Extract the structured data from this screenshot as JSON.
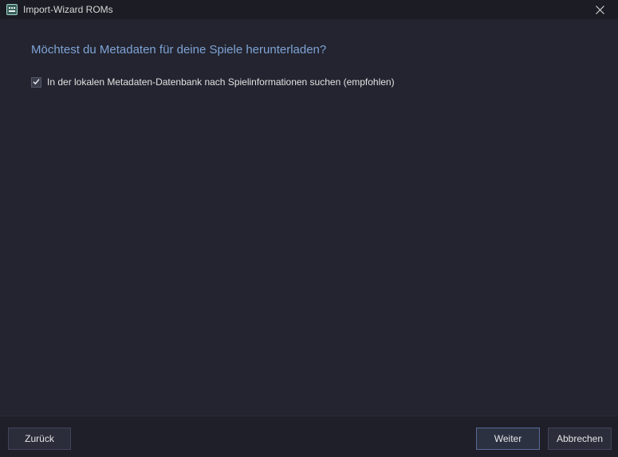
{
  "window": {
    "title": "Import-Wizard ROMs",
    "icon": "rom-cartridge-icon",
    "close_icon": "close-icon"
  },
  "main": {
    "heading": "Möchtest du Metadaten für deine Spiele herunterladen?",
    "option": {
      "label": "In der lokalen Metadaten-Datenbank nach Spielinformationen suchen (empfohlen)",
      "checked": true
    }
  },
  "footer": {
    "back_label": "Zurück",
    "next_label": "Weiter",
    "cancel_label": "Abbrechen"
  },
  "colors": {
    "background": "#23242f",
    "titlebar": "#1b1c24",
    "heading": "#7fa3d6",
    "accent_border": "#5a6a96"
  }
}
